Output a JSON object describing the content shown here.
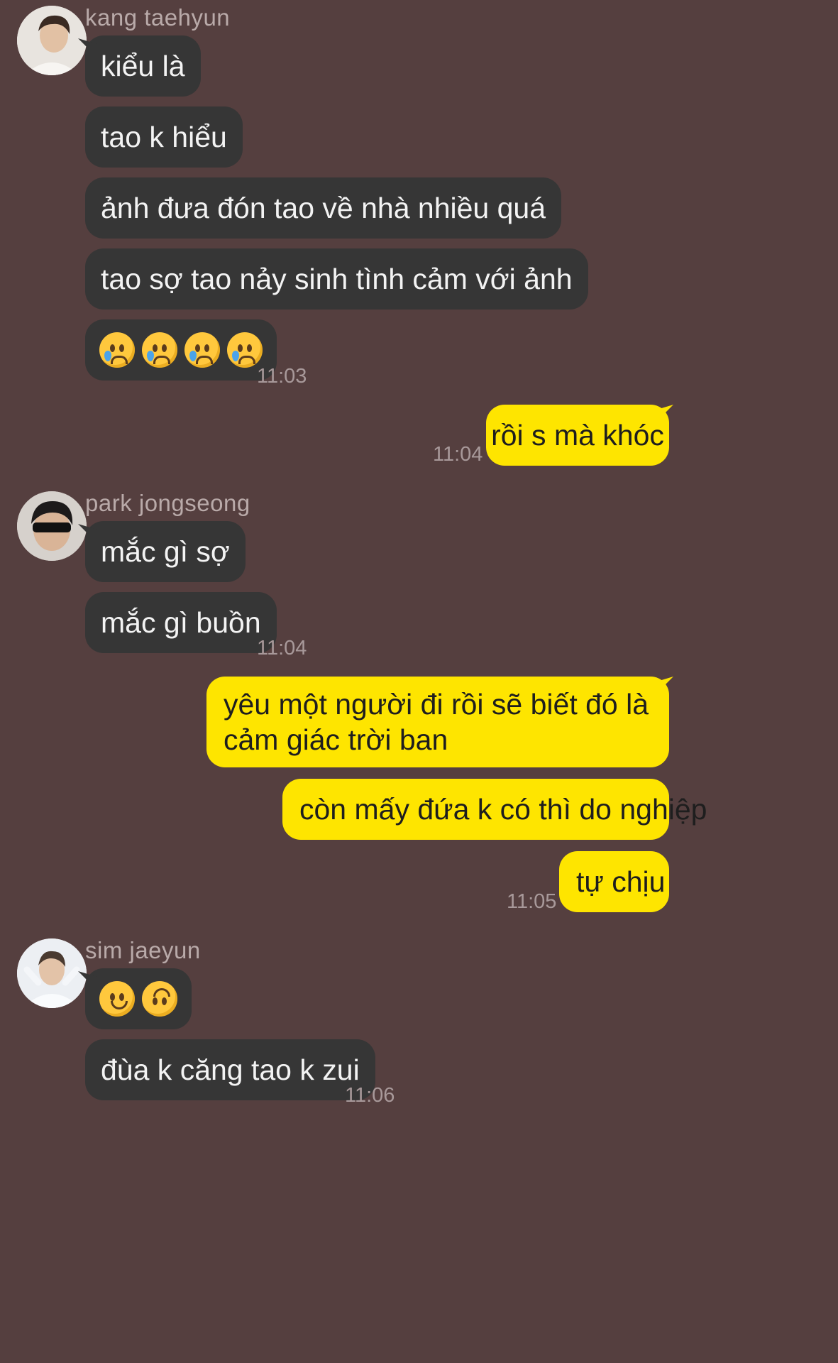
{
  "colors": {
    "background": "#553f3f",
    "incoming_bubble": "#363636",
    "outgoing_bubble": "#fee500",
    "timestamp": "#a8999a"
  },
  "groups": [
    {
      "sender": "kang taehyun",
      "avatar_icon": "profile-photo-kang-taehyun",
      "messages": [
        "kiểu là",
        "tao k hiểu",
        "ảnh đưa đón tao về nhà nhiều quá",
        "tao sợ tao nảy sinh tình cảm với ảnh"
      ],
      "emoji_message": [
        "crying-face-emoji",
        "crying-face-emoji",
        "crying-face-emoji",
        "crying-face-emoji"
      ],
      "time": "11:03"
    },
    {
      "sender": "me",
      "messages": [
        "rồi s mà khóc"
      ],
      "time": "11:04"
    },
    {
      "sender": "park jongseong",
      "avatar_icon": "profile-photo-park-jongseong",
      "messages": [
        "mắc gì sợ",
        "mắc gì buồn"
      ],
      "time": "11:04"
    },
    {
      "sender": "me",
      "messages": [
        "yêu một người đi rồi sẽ biết đó là cảm giác trời ban",
        "còn mấy đứa k có thì do nghiệp",
        "tự chịu"
      ],
      "time": "11:05"
    },
    {
      "sender": "sim jaeyun",
      "avatar_icon": "profile-photo-sim-jaeyun",
      "emoji_message": [
        "slightly-smiling-face-emoji",
        "upside-down-face-emoji"
      ],
      "messages": [
        "đùa k căng tao k zui"
      ],
      "time": "11:06"
    }
  ]
}
